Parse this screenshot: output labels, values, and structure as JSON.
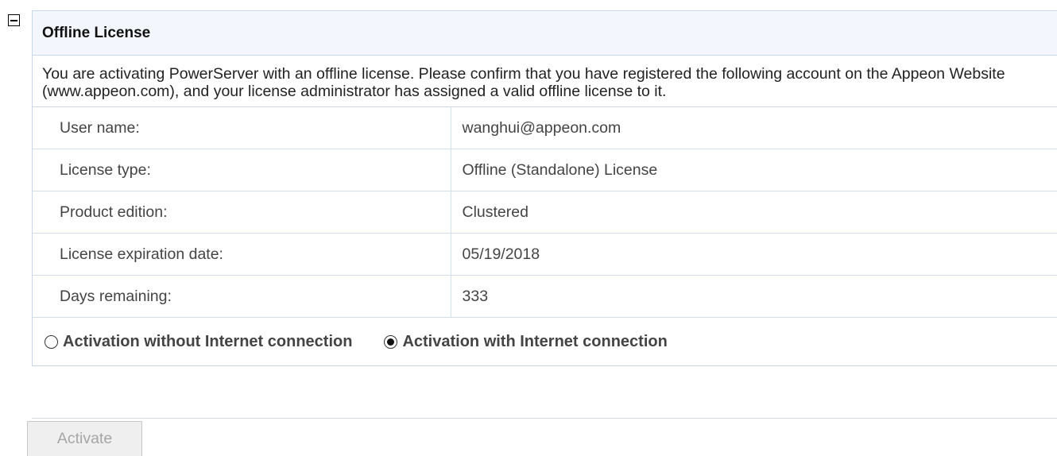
{
  "panel": {
    "title": "Offline License",
    "intro": "You are activating PowerServer with an offline license. Please confirm that you have registered the following account on the Appeon Website (www.appeon.com), and your license administrator has assigned a valid offline license to it."
  },
  "info_rows": [
    {
      "label": "User name:",
      "value": "wanghui@appeon.com"
    },
    {
      "label": "License type:",
      "value": "Offline (Standalone) License"
    },
    {
      "label": "Product edition:",
      "value": "Clustered"
    },
    {
      "label": "License expiration date:",
      "value": "05/19/2018"
    },
    {
      "label": "Days remaining:",
      "value": "333"
    }
  ],
  "activation_options": [
    {
      "label": "Activation without Internet connection",
      "selected": false
    },
    {
      "label": "Activation with Internet connection",
      "selected": true
    }
  ],
  "activate_button": {
    "label": "Activate",
    "enabled": false
  }
}
